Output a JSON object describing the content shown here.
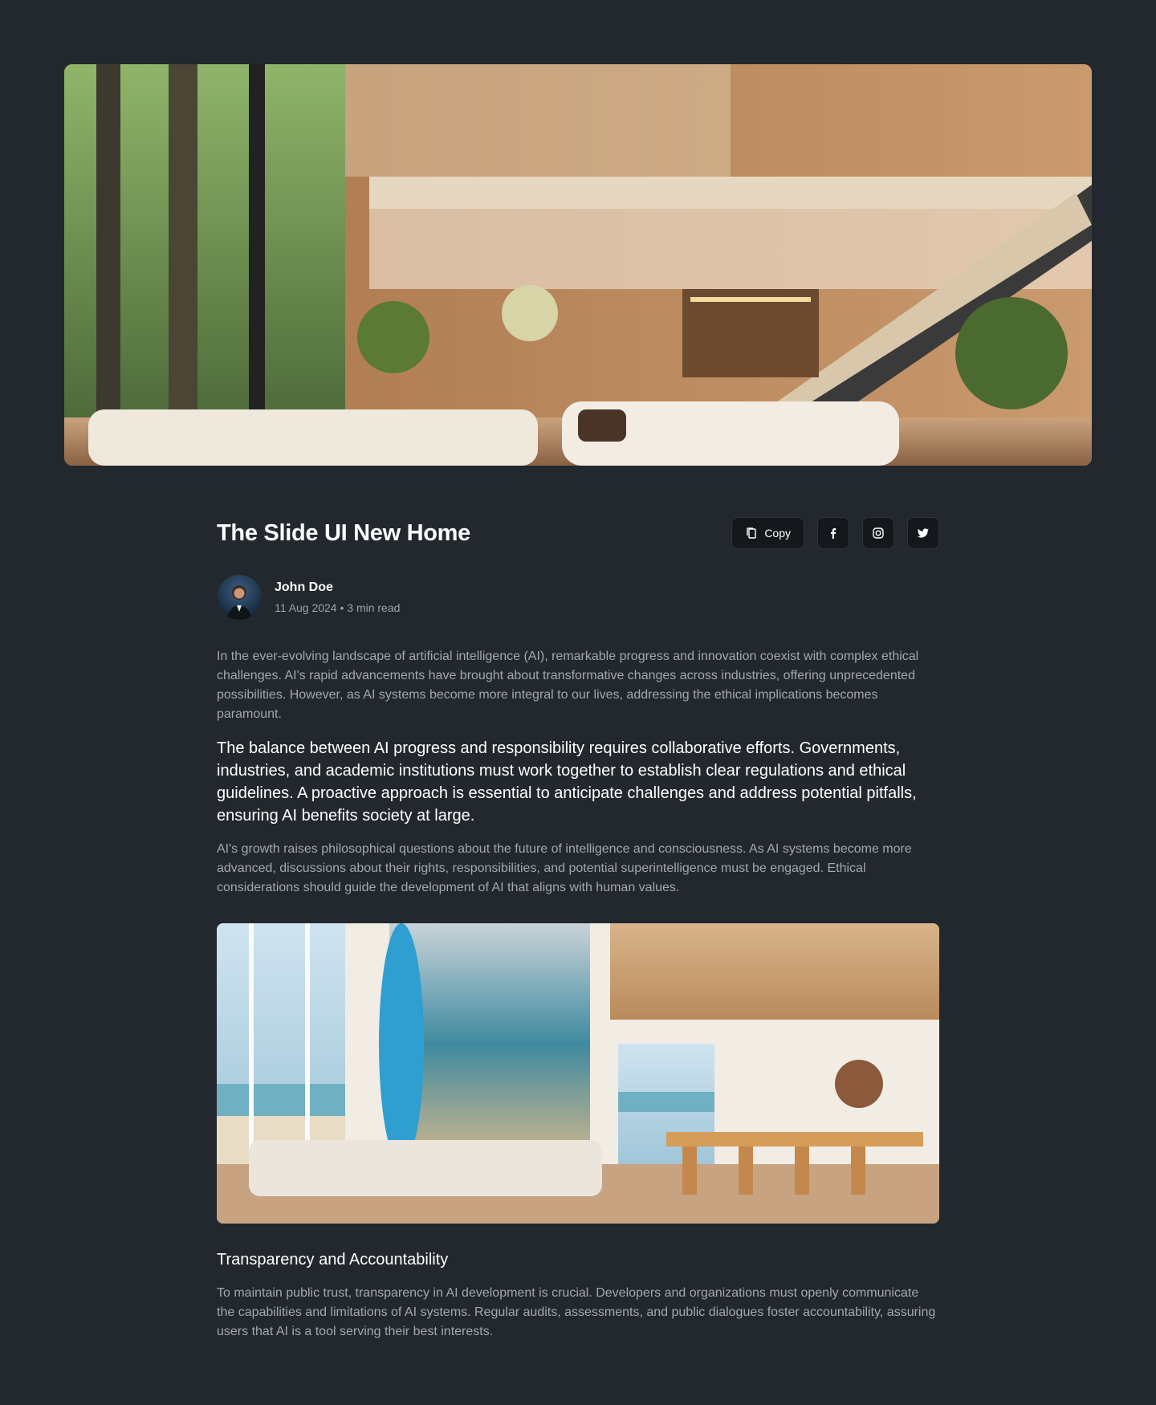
{
  "hero": {
    "image_alt": "Modern wooden home interior with staircase and forest view"
  },
  "article": {
    "title": "The Slide UI New Home",
    "actions": {
      "copy_label": "Copy",
      "icons": [
        "copy-icon",
        "facebook-icon",
        "instagram-icon",
        "twitter-icon"
      ]
    },
    "author": {
      "name": "John Doe",
      "meta": "11 Aug 2024 • 3 min read"
    },
    "paragraph_1": "In the ever-evolving landscape of artificial intelligence (AI), remarkable progress and innovation coexist with complex ethical challenges. AI's rapid advancements have brought about transformative changes across industries, offering unprecedented possibilities. However, as AI systems become more integral to our lives, addressing the ethical implications becomes paramount.",
    "lead": "The balance between AI progress and responsibility requires collaborative efforts. Governments, industries, and academic institutions must work together to establish clear regulations and ethical guidelines. A proactive approach is essential to anticipate challenges and address potential pitfalls, ensuring AI benefits society at large.",
    "paragraph_2": "AI's growth raises philosophical questions about the future of intelligence and consciousness. As AI systems become more advanced, discussions about their rights, responsibilities, and potential superintelligence must be engaged. Ethical considerations should guide the development of AI that aligns with human values.",
    "inline_image_alt": "Beach house living room with surfboard and dining area",
    "section_heading": "Transparency and Accountability",
    "paragraph_3": "To maintain public trust, transparency in AI development is crucial. Developers and organizations must openly communicate the capabilities and limitations of AI systems. Regular audits, assessments, and public dialogues foster accountability, assuring users that AI is a tool serving their best interests."
  },
  "colors": {
    "background": "#22282e",
    "button_bg": "#14181c",
    "text_muted": "#a3a8ae",
    "text_strong": "#ffffff"
  }
}
